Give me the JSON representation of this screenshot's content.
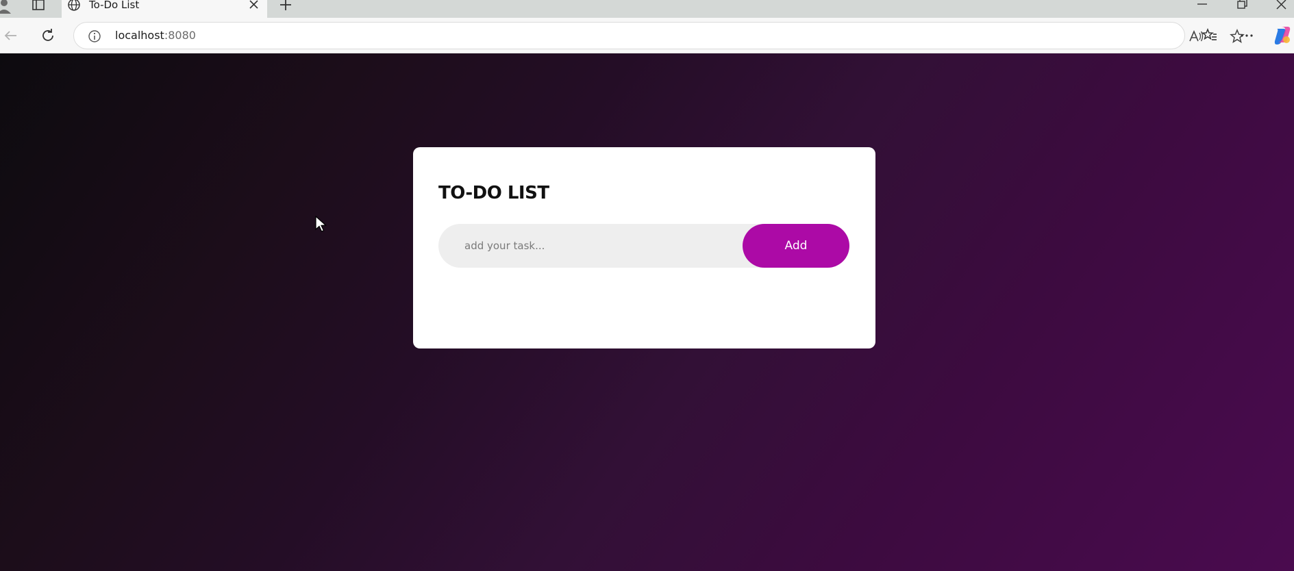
{
  "browser": {
    "tab_title": "To-Do List",
    "url_host": "localhost",
    "url_port": ":8080"
  },
  "app": {
    "title": "TO-DO LIST",
    "input_placeholder": "add your task...",
    "input_value": "",
    "add_label": "Add",
    "accent_color": "#ac0aa6"
  },
  "icons": {
    "profile": "profile-icon",
    "tab_actions": "tab-actions-icon",
    "globe": "globe-icon",
    "close": "close-icon",
    "new_tab": "plus-icon",
    "back": "back-arrow-icon",
    "reload": "reload-icon",
    "info": "info-icon",
    "read_aloud": "read-aloud-icon",
    "favorite": "star-icon",
    "favorites": "favorites-icon",
    "more": "more-icon",
    "copilot": "copilot-icon",
    "cursor": "mouse-cursor-icon"
  }
}
